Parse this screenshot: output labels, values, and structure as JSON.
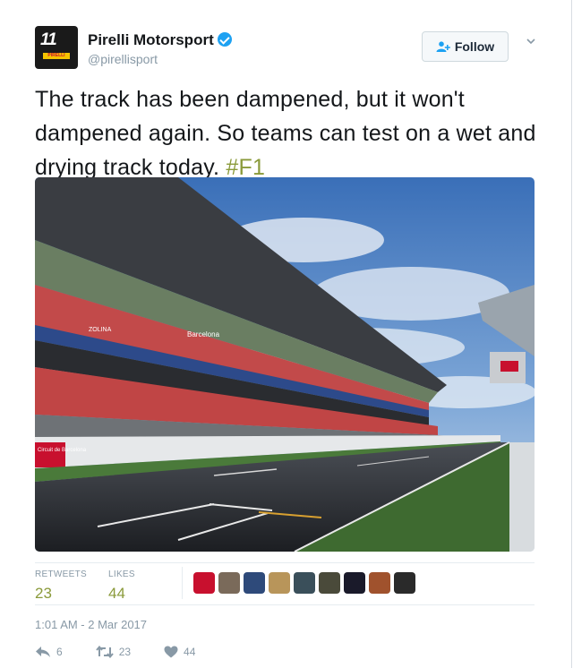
{
  "tweet": {
    "author_name": "Pirelli Motorsport",
    "author_handle": "@pirellisport",
    "avatar_text": "11",
    "avatar_brand": "PIRELLI",
    "follow_label": "Follow",
    "text": "The track has been dampened, but it won't dampened again. So teams can test on a wet and drying track today.",
    "hashtag": "#F1",
    "photo_labels": [
      "Circuit de Barcelona",
      "ZOLINA",
      "Barcelona"
    ],
    "stats": {
      "retweets_label": "RETWEETS",
      "retweets_value": "23",
      "likes_label": "LIKES",
      "likes_value": "44"
    },
    "timestamp": "1:01 AM - 2 Mar 2017",
    "actions": {
      "reply_count": "6",
      "retweet_count": "23",
      "like_count": "44"
    }
  },
  "colors": {
    "accent": "#8a9a3a",
    "verified": "#1da1f2",
    "muted": "#8899a6"
  },
  "likers": [
    {
      "name": "liker-1",
      "color": "#c8102e"
    },
    {
      "name": "liker-2",
      "color": "#7a6a5a"
    },
    {
      "name": "liker-3",
      "color": "#2e4a7a"
    },
    {
      "name": "liker-4",
      "color": "#b8955a"
    },
    {
      "name": "liker-5",
      "color": "#3a4f5a"
    },
    {
      "name": "liker-6",
      "color": "#4a4a3a"
    },
    {
      "name": "liker-7",
      "color": "#1a1a2a"
    },
    {
      "name": "liker-8",
      "color": "#a0522d"
    },
    {
      "name": "liker-9",
      "color": "#2a2a2a"
    }
  ]
}
